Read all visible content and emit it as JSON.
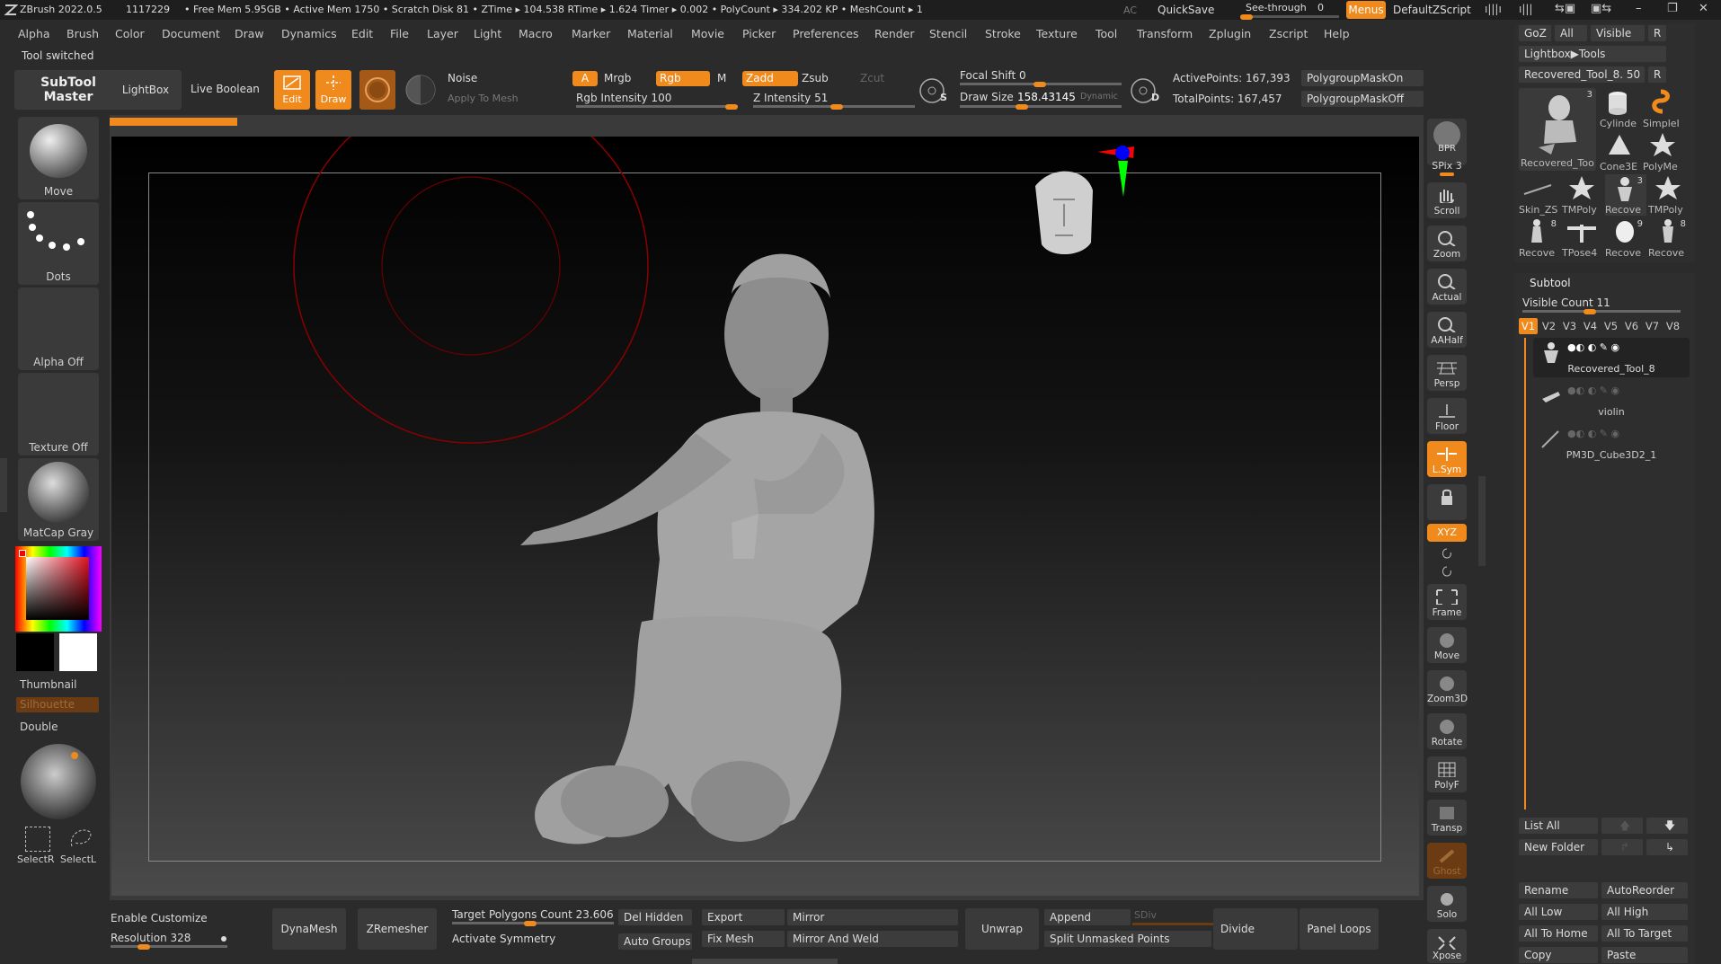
{
  "titlebar": {
    "app": "ZBrush 2022.0.5",
    "session": "1117229",
    "stats": "• Free Mem 5.95GB • Active Mem 1750 • Scratch Disk 81 •  ZTime ▸ 104.538 RTime ▸ 1.624 Timer ▸ 0.002 • PolyCount ▸ 334.202 KP  • MeshCount ▸ 1",
    "ac": "AC",
    "quicksave": "QuickSave",
    "seethrough": "See-through",
    "seethrough_value": "0",
    "menus": "Menus",
    "script": "DefaultZScript"
  },
  "menubar": {
    "items": [
      "Alpha",
      "Brush",
      "Color",
      "Document",
      "Draw",
      "Dynamics",
      "Edit",
      "File",
      "Layer",
      "Light",
      "Macro",
      "Marker",
      "Material",
      "Movie",
      "Picker",
      "Preferences",
      "Render",
      "Stencil",
      "Stroke",
      "Texture",
      "Tool",
      "Transform",
      "Zplugin",
      "Zscript",
      "Help"
    ]
  },
  "status": "Tool switched",
  "shelf": {
    "subtool_master": [
      "SubTool",
      "Master"
    ],
    "lightbox": "LightBox",
    "live_boolean": "Live Boolean",
    "edit": "Edit",
    "draw": "Draw",
    "noise": "Noise",
    "apply_to_mesh": "Apply To Mesh",
    "a": "A",
    "mrgb": "Mrgb",
    "rgb": "Rgb",
    "m": "M",
    "zadd": "Zadd",
    "zsub": "Zsub",
    "zcut": "Zcut",
    "rgb_intensity": "Rgb Intensity 100",
    "rgb_intensity_value": 100,
    "z_intensity": "Z Intensity 51",
    "z_intensity_value": 51,
    "focal_shift": "Focal Shift 0",
    "draw_size": "Draw Size",
    "draw_size_value": "158.43145",
    "dynamic": "Dynamic",
    "active_points": "ActivePoints: 167,393",
    "total_points": "TotalPoints: 167,457",
    "polygroup_mask_on": "PolygroupMaskOn",
    "polygroup_mask_off": "PolygroupMaskOff",
    "s": "S",
    "d": "D"
  },
  "leftpanel": {
    "move": "Move",
    "dots": "Dots",
    "alpha_off": "Alpha Off",
    "texture_off": "Texture Off",
    "matcap": "MatCap Gray",
    "thumbnail": "Thumbnail",
    "silhouette": "Silhouette",
    "double": "Double",
    "selectr": "SelectR",
    "selectl": "SelectL"
  },
  "righttools": [
    {
      "name": "bpr",
      "label": "BPR"
    },
    {
      "name": "spix",
      "label": "SPix 3"
    },
    {
      "name": "scroll",
      "label": "Scroll"
    },
    {
      "name": "zoom",
      "label": "Zoom"
    },
    {
      "name": "actual",
      "label": "Actual"
    },
    {
      "name": "aahalf",
      "label": "AAHalf"
    },
    {
      "name": "persp",
      "label": "Persp"
    },
    {
      "name": "floor",
      "label": "Floor"
    },
    {
      "name": "lsym",
      "label": "L.Sym"
    },
    {
      "name": "xyz",
      "label": "XYZ"
    },
    {
      "name": "frame",
      "label": "Frame"
    },
    {
      "name": "move",
      "label": "Move"
    },
    {
      "name": "zoom3d",
      "label": "Zoom3D"
    },
    {
      "name": "rotate",
      "label": "Rotate"
    },
    {
      "name": "polyf",
      "label": "PolyF"
    },
    {
      "name": "transp",
      "label": "Transp"
    },
    {
      "name": "ghost",
      "label": "Ghost"
    },
    {
      "name": "solo",
      "label": "Solo"
    },
    {
      "name": "xpose",
      "label": "Xpose"
    }
  ],
  "toolpanel": {
    "goz": "GoZ",
    "all": "All",
    "visible": "Visible",
    "r": "R",
    "lightbox_tools": "Lightbox▶Tools",
    "recovered_tool": "Recovered_Tool_8. 50",
    "tools": [
      {
        "name": "Recovered_Too",
        "badge": "3"
      },
      {
        "name": "Cylinde",
        "badge": ""
      },
      {
        "name": "SimpleI",
        "badge": ""
      },
      {
        "name": "Cone3E",
        "badge": ""
      },
      {
        "name": "PolyMe",
        "badge": ""
      },
      {
        "name": "Skin_ZS",
        "badge": ""
      },
      {
        "name": "TMPoly",
        "badge": ""
      },
      {
        "name": "Recove",
        "badge": "3"
      },
      {
        "name": "TMPoly",
        "badge": ""
      },
      {
        "name": "Recove",
        "badge": "8"
      },
      {
        "name": "TPose4",
        "badge": ""
      },
      {
        "name": "Recove",
        "badge": "9"
      },
      {
        "name": "Recove",
        "badge": "8"
      }
    ],
    "subtool": "Subtool",
    "visible_count": "Visible Count 11",
    "vtabs": [
      "V1",
      "V2",
      "V3",
      "V4",
      "V5",
      "V6",
      "V7",
      "V8"
    ],
    "subtools": [
      "Recovered_Tool_8",
      "violin",
      "PM3D_Cube3D2_1"
    ],
    "list_all": "List All",
    "new_folder": "New Folder",
    "rename": "Rename",
    "autoreorder": "AutoReorder",
    "all_low": "All Low",
    "all_high": "All High",
    "all_to_home": "All To Home",
    "all_to_target": "All To Target",
    "copy": "Copy",
    "paste": "Paste"
  },
  "bottombar": {
    "enable_customize": "Enable Customize",
    "resolution": "Resolution 328",
    "dynamesh": "DynaMesh",
    "zremesher": "ZRemesher",
    "target_polygons": "Target Polygons Count 23.606",
    "activate_symmetry": "Activate Symmetry",
    "del_hidden": "Del Hidden",
    "auto_groups": "Auto Groups",
    "export": "Export",
    "fix_mesh": "Fix Mesh",
    "mirror": "Mirror",
    "mirror_and_weld": "Mirror And Weld",
    "unwrap": "Unwrap",
    "append": "Append",
    "sdiv": "SDiv",
    "split_unmasked": "Split Unmasked Points",
    "divide": "Divide",
    "panel_loops": "Panel Loops"
  },
  "colors": {
    "accent": "#f08a1c",
    "bg": "#2b2b2b",
    "canvas": "#000000"
  }
}
